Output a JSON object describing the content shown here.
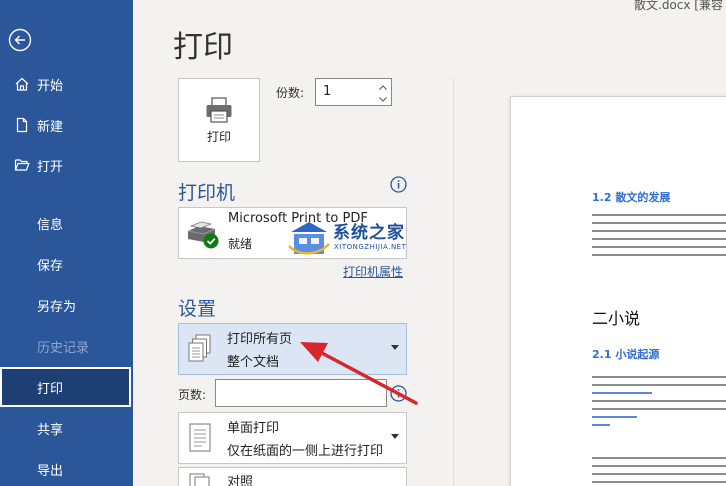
{
  "window": {
    "file_title": "散文.docx [兼容"
  },
  "sidebar": {
    "items": [
      {
        "label": "开始",
        "icon": "home-icon"
      },
      {
        "label": "新建",
        "icon": "new-document-icon"
      },
      {
        "label": "打开",
        "icon": "folder-open-icon"
      },
      {
        "label": "信息"
      },
      {
        "label": "保存"
      },
      {
        "label": "另存为"
      },
      {
        "label": "历史记录",
        "disabled": true
      },
      {
        "label": "打印",
        "active": true
      },
      {
        "label": "共享"
      },
      {
        "label": "导出"
      }
    ]
  },
  "main": {
    "title": "打印",
    "print_button_label": "打印",
    "copies": {
      "label": "份数:",
      "value": "1"
    },
    "printer": {
      "section_title": "打印机",
      "name": "Microsoft Print to PDF",
      "status": "就绪",
      "properties_link": "打印机属性"
    },
    "settings": {
      "section_title": "设置",
      "pages_dropdown": {
        "main": "打印所有页",
        "sub": "整个文档"
      },
      "pages_field": {
        "label": "页数:",
        "value": ""
      },
      "sides_dropdown": {
        "main": "单面打印",
        "sub": "仅在纸面的一侧上进行打印"
      },
      "collate_dropdown": {
        "main": "对照"
      }
    }
  },
  "watermark": {
    "title": "系统之家",
    "subtitle": "XITONGZHIJIA.NET"
  },
  "preview": {
    "heading_1": "1.2 散文的发展",
    "heading_2": "二小说",
    "heading_3": "2.1 小说起源"
  },
  "colors": {
    "sidebar_bg": "#2b579a",
    "sidebar_active_bg": "#1d3f73",
    "accent": "#2b579a",
    "selected_dropdown_bg": "#dbe5f4",
    "arrow": "#d9262c"
  }
}
